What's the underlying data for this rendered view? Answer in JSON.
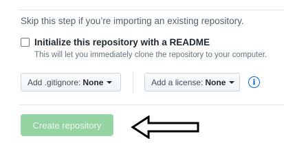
{
  "skip_text": "Skip this step if you’re importing an existing repository.",
  "readme": {
    "label": "Initialize this repository with a README",
    "note": "This will let you immediately clone the repository to your computer.",
    "checked": false
  },
  "gitignore": {
    "label": "Add .gitignore:",
    "value": "None"
  },
  "license": {
    "label": "Add a license:",
    "value": "None"
  },
  "info_glyph": "i",
  "create_button": {
    "label": "Create repository",
    "enabled": false
  },
  "colors": {
    "create_button_bg": "#94d3a2",
    "link_blue": "#0366d6"
  },
  "icons": {
    "caret": "caret-down-icon",
    "info": "info-icon",
    "arrow": "left-arrow-icon"
  }
}
